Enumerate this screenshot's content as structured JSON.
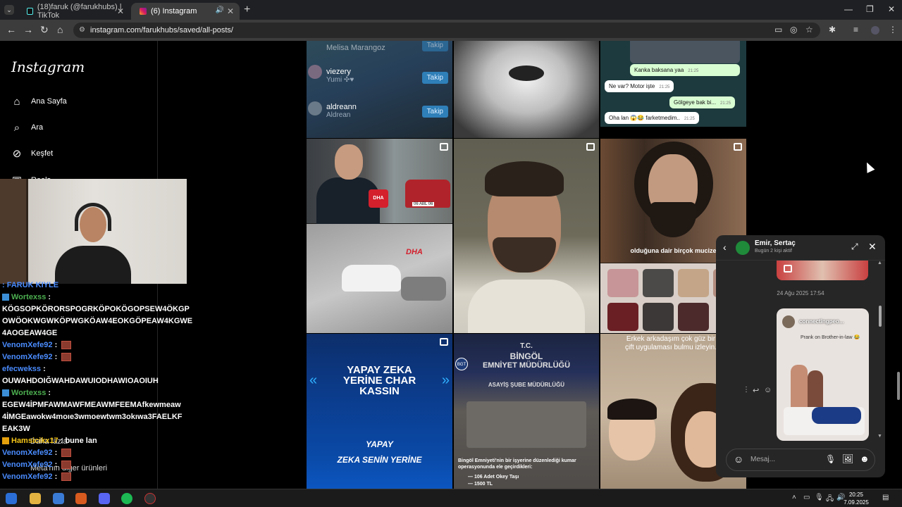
{
  "browser": {
    "tabs": [
      {
        "label": "(18)faruk (@farukhubs) | TikTok",
        "active": false
      },
      {
        "label": "(6) Instagram",
        "active": true
      }
    ],
    "url": "instagram.com/farukhubs/saved/all-posts/",
    "new_tab_glyph": "+"
  },
  "sidebar": {
    "logo": "Instagram",
    "items": [
      {
        "label": "Ana Sayfa",
        "icon": "home-icon"
      },
      {
        "label": "Ara",
        "icon": "search-icon"
      },
      {
        "label": "Keşfet",
        "icon": "compass-icon"
      },
      {
        "label": "Reels",
        "icon": "reels-icon"
      }
    ],
    "more_label": "Daha fazla",
    "meta_label": "Meta'nın diğer ürünleri"
  },
  "chat": {
    "lines": [
      {
        "user": "",
        "text": ": FARUK KIYLE",
        "color": "blue",
        "badge": false
      },
      {
        "user": "Wortexss",
        "text": " :",
        "color": "green",
        "badge": true
      },
      {
        "user": "",
        "text": "KÖGSOPKÖRORSPOGRKÖPOKÖGOPSEW4ÖKGP",
        "color": "white",
        "badge": false
      },
      {
        "user": "",
        "text": "OWÖOKWGWKÖPWGKÖAW4EOKGÖPEAW4KGWE",
        "color": "white",
        "badge": false
      },
      {
        "user": "",
        "text": "4AOGEAW4GE",
        "color": "white",
        "badge": false
      },
      {
        "user": "VenomXefe92",
        "text": " : ",
        "color": "blue",
        "badge": false,
        "emote": true
      },
      {
        "user": "VenomXefe92",
        "text": " : ",
        "color": "blue",
        "badge": false,
        "emote": true
      },
      {
        "user": "efecwekss",
        "text": " :",
        "color": "blue",
        "badge": false
      },
      {
        "user": "",
        "text": "OUWAHDOIĞWAHDAWUIODHAWIOAOIUH",
        "color": "white",
        "badge": false
      },
      {
        "user": "Wortexss",
        "text": " :",
        "color": "green",
        "badge": true
      },
      {
        "user": "",
        "text": "EGEW4İPMFAWMAWFMEAWMFEEMAfkewmeaw",
        "color": "white",
        "badge": false
      },
      {
        "user": "",
        "text": "4İMGEawokw4moıe3wmoewtwm3okıwa3FAELKF",
        "color": "white",
        "badge": false
      },
      {
        "user": "",
        "text": "EAK3W",
        "color": "white",
        "badge": false
      },
      {
        "user": "Hamsicikx17",
        "text": " : bune lan",
        "color": "yellow",
        "badge": true
      },
      {
        "user": "VenomXefe92",
        "text": " : ",
        "color": "blue",
        "badge": false,
        "emote": true
      },
      {
        "user": "VenomXefe92",
        "text": " : ",
        "color": "blue",
        "badge": false,
        "emote": true
      },
      {
        "user": "VenomXefe92",
        "text": " : ",
        "color": "blue",
        "badge": false,
        "emote": true
      }
    ]
  },
  "posts": {
    "suggestions": [
      {
        "name": "Melisa Marangoz",
        "sub": "",
        "button": "Takip"
      },
      {
        "name": "viezery",
        "sub": "Yumi ✣♥",
        "button": "Takip"
      },
      {
        "name": "aldreann",
        "sub": "Aldrean",
        "button": "Takip"
      }
    ],
    "chat_bubbles": [
      {
        "text": "Kanka baksana yaa",
        "time": "21:25",
        "side": "right"
      },
      {
        "text": "Ne var? Motor işte",
        "time": "21:25",
        "side": "left"
      },
      {
        "text": "Gölgeye bak bi...",
        "time": "21:25",
        "side": "right"
      },
      {
        "text": "Oha lan 😱😂 farketmedim..",
        "time": "21:25",
        "side": "left"
      }
    ],
    "dha_label": "DHA",
    "plate_text": "06 ABL 06",
    "subtitle_mucize": "olduğuna dair birçok mucize",
    "yapay_zeka_title": "YAPAY ZEKA YERİNE CHAR KASSIN",
    "yapay_zeka_sub1": "YAPAY",
    "yapay_zeka_sub2": "ZEKA SENİN YERİNE",
    "emniyet_tc": "T.C.",
    "emniyet_city": "BİNGÖL",
    "emniyet_title": "EMNİYET MÜDÜRLÜĞÜ",
    "emniyet_sub": "ASAYİŞ ŞUBE MÜDÜRLÜĞÜ",
    "emniyet_caption": "Bingöl Emniyeti'nin bir işyerine düzenlediği kumar operasyonunda ele geçirdikleri:",
    "emniyet_items": [
      "— 106 Adet Okey Taşı",
      "— 1500 TL"
    ],
    "bgt_label": "BGT",
    "couple_caption": "Erkek arkadaşım çok güz bir çift uygulaması bulmu izleyin."
  },
  "dm": {
    "title": "Emir, Sertaç",
    "status": "Bugün 2 kişi aktif",
    "date": "24 Ağu 2025 17:54",
    "shared_user": "connectingpeo...",
    "shared_caption": "Prank on Brother-in-law 😂",
    "input_placeholder": "Mesaj..."
  },
  "taskbar": {
    "time": "20:25",
    "date": "7.09.2025"
  }
}
